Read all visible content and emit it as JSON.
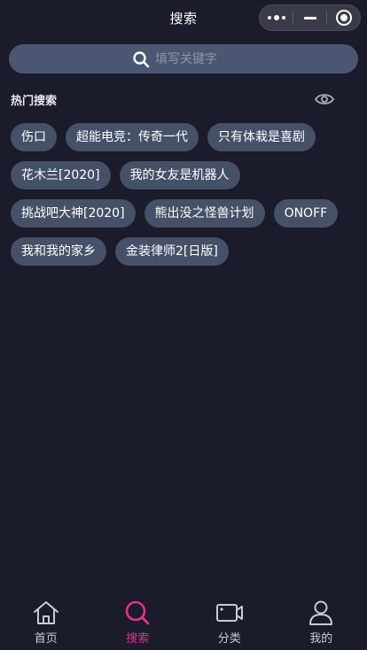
{
  "header": {
    "title": "搜索",
    "capsule": {
      "more_icon": "more-dots-icon",
      "minimize_icon": "minimize-icon",
      "close_icon": "target-circle-icon"
    }
  },
  "search": {
    "placeholder": "填写关键字",
    "value": "",
    "icon": "search-icon"
  },
  "hot": {
    "title": "热门搜索",
    "toggle_icon": "eye-icon",
    "tags": [
      "伤口",
      "超能电竞：传奇一代",
      "只有体栽是喜剧",
      "花木兰[2020]",
      "我的女友是机器人",
      "挑战吧大神[2020]",
      "熊出没之怪兽计划",
      "ONOFF",
      "我和我的家乡",
      "金装律师2[日版]"
    ]
  },
  "nav": {
    "items": [
      {
        "label": "首页",
        "icon": "home-icon",
        "active": false
      },
      {
        "label": "搜索",
        "icon": "search-icon",
        "active": true
      },
      {
        "label": "分类",
        "icon": "video-camera-icon",
        "active": false
      },
      {
        "label": "我的",
        "icon": "user-icon",
        "active": false
      }
    ]
  },
  "colors": {
    "background": "#1a1b2b",
    "tag_bg": "#465067",
    "search_bg": "#4a5672",
    "accent": "#e2338a"
  }
}
